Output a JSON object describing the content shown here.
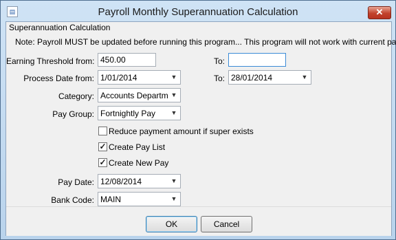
{
  "window": {
    "title": "Payroll Monthly Superannuation Calculation",
    "close_glyph": "✕",
    "icon_glyph": "▤"
  },
  "group": {
    "label": "Superannuation Calculation"
  },
  "note": "Note:  Payroll MUST be updated before running this program...  This program will not work with current pays.",
  "earning_threshold": {
    "from_label": "Earning Threshold from:",
    "from_value": "450.00",
    "to_label": "To:",
    "to_value": ""
  },
  "process_date": {
    "from_label": "Process Date from:",
    "from_value": "1/01/2014",
    "to_label": "To:",
    "to_value": "28/01/2014"
  },
  "category": {
    "label": "Category:",
    "value": "Accounts Departmen"
  },
  "pay_group": {
    "label": "Pay Group:",
    "value": "Fortnightly Pay"
  },
  "options": [
    {
      "label": "Reduce payment amount if super exists",
      "checked": false
    },
    {
      "label": "Create Pay List",
      "checked": true
    },
    {
      "label": "Create New Pay",
      "checked": true
    }
  ],
  "check_glyph": "✓",
  "dropdown_glyph": "▼",
  "pay_date": {
    "label": "Pay Date:",
    "value": "12/08/2014"
  },
  "bank_code": {
    "label": "Bank Code:",
    "value": "MAIN"
  },
  "buttons": {
    "ok": "OK",
    "cancel": "Cancel"
  }
}
